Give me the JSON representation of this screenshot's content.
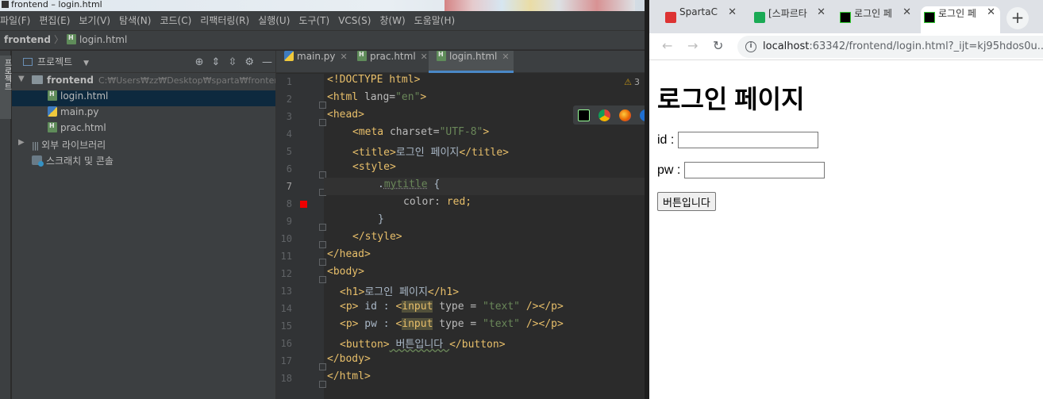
{
  "ide": {
    "window_title": "frontend – login.html",
    "menu": [
      "파일(F)",
      "편집(E)",
      "보기(V)",
      "탐색(N)",
      "코드(C)",
      "리팩터링(R)",
      "실행(U)",
      "도구(T)",
      "VCS(S)",
      "창(W)",
      "도움말(H)"
    ],
    "nav": {
      "folder": "frontend",
      "file": "login.html"
    },
    "side_tab": "프로젝트",
    "project_panel": {
      "title": "프로젝트",
      "root": {
        "name": "frontend",
        "path": "C:₩Users₩zz₩Desktop₩sparta₩frontend"
      },
      "files": [
        "login.html",
        "main.py",
        "prac.html"
      ],
      "external_libraries": "외부 라이브러리",
      "scratches": "스크래치 및 콘솔"
    },
    "tabs": [
      "main.py",
      "prac.html",
      "login.html"
    ],
    "active_tab": "login.html",
    "warnings": "3",
    "line_numbers": [
      "1",
      "2",
      "3",
      "4",
      "5",
      "6",
      "7",
      "8",
      "9",
      "10",
      "11",
      "12",
      "13",
      "14",
      "15",
      "16",
      "17",
      "18"
    ],
    "code": {
      "l1": "<!DOCTYPE html>",
      "l2a": "<html ",
      "l2b": "lang=",
      "l2c": "\"en\"",
      "l2d": ">",
      "l3": "<head>",
      "l4a": "<meta ",
      "l4b": "charset=",
      "l4c": "\"UTF-8\"",
      "l4d": ">",
      "l5a": "<title>",
      "l5b": "로그인 페이지",
      "l5c": "</title>",
      "l6": "<style>",
      "l7a": ".",
      "l7b": "mytitle",
      "l7c": " {",
      "l8a": "color: ",
      "l8b": "red;",
      "l9": "}",
      "l10": "</style>",
      "l11": "</head>",
      "l12": "<body>",
      "l13a": "<h1>",
      "l13b": "로그인 페이지",
      "l13c": "</h1>",
      "l14a": "<p>",
      "l14b": " id : ",
      "l14c": "<",
      "l14d": "input",
      "l14e": " type = ",
      "l14f": "\"text\"",
      "l14g": " /></p>",
      "l15a": "<p>",
      "l15b": " pw : ",
      "l15c": "<",
      "l15d": "input",
      "l15e": " type = ",
      "l15f": "\"text\"",
      "l15g": " /></p>",
      "l16a": "<button>",
      "l16b": " 버튼입니다 ",
      "l16c": "</button>",
      "l17": "</body>",
      "l18": "</html>"
    }
  },
  "browser": {
    "tabs": [
      {
        "title": "SpartaC",
        "icon": "sparta-icon"
      },
      {
        "title": "[스파르타",
        "icon": "sparta-green-icon"
      },
      {
        "title": "로그인 페",
        "icon": "pycharm-icon"
      },
      {
        "title": "로그인 페",
        "icon": "pycharm-icon"
      }
    ],
    "url_host": "localhost",
    "url_rest": ":63342/frontend/login.html?_ijt=kj95hdos0u...",
    "page": {
      "heading": "로그인 페이지",
      "id_label": "id :",
      "pw_label": "pw :",
      "button": "버튼입니다"
    }
  }
}
